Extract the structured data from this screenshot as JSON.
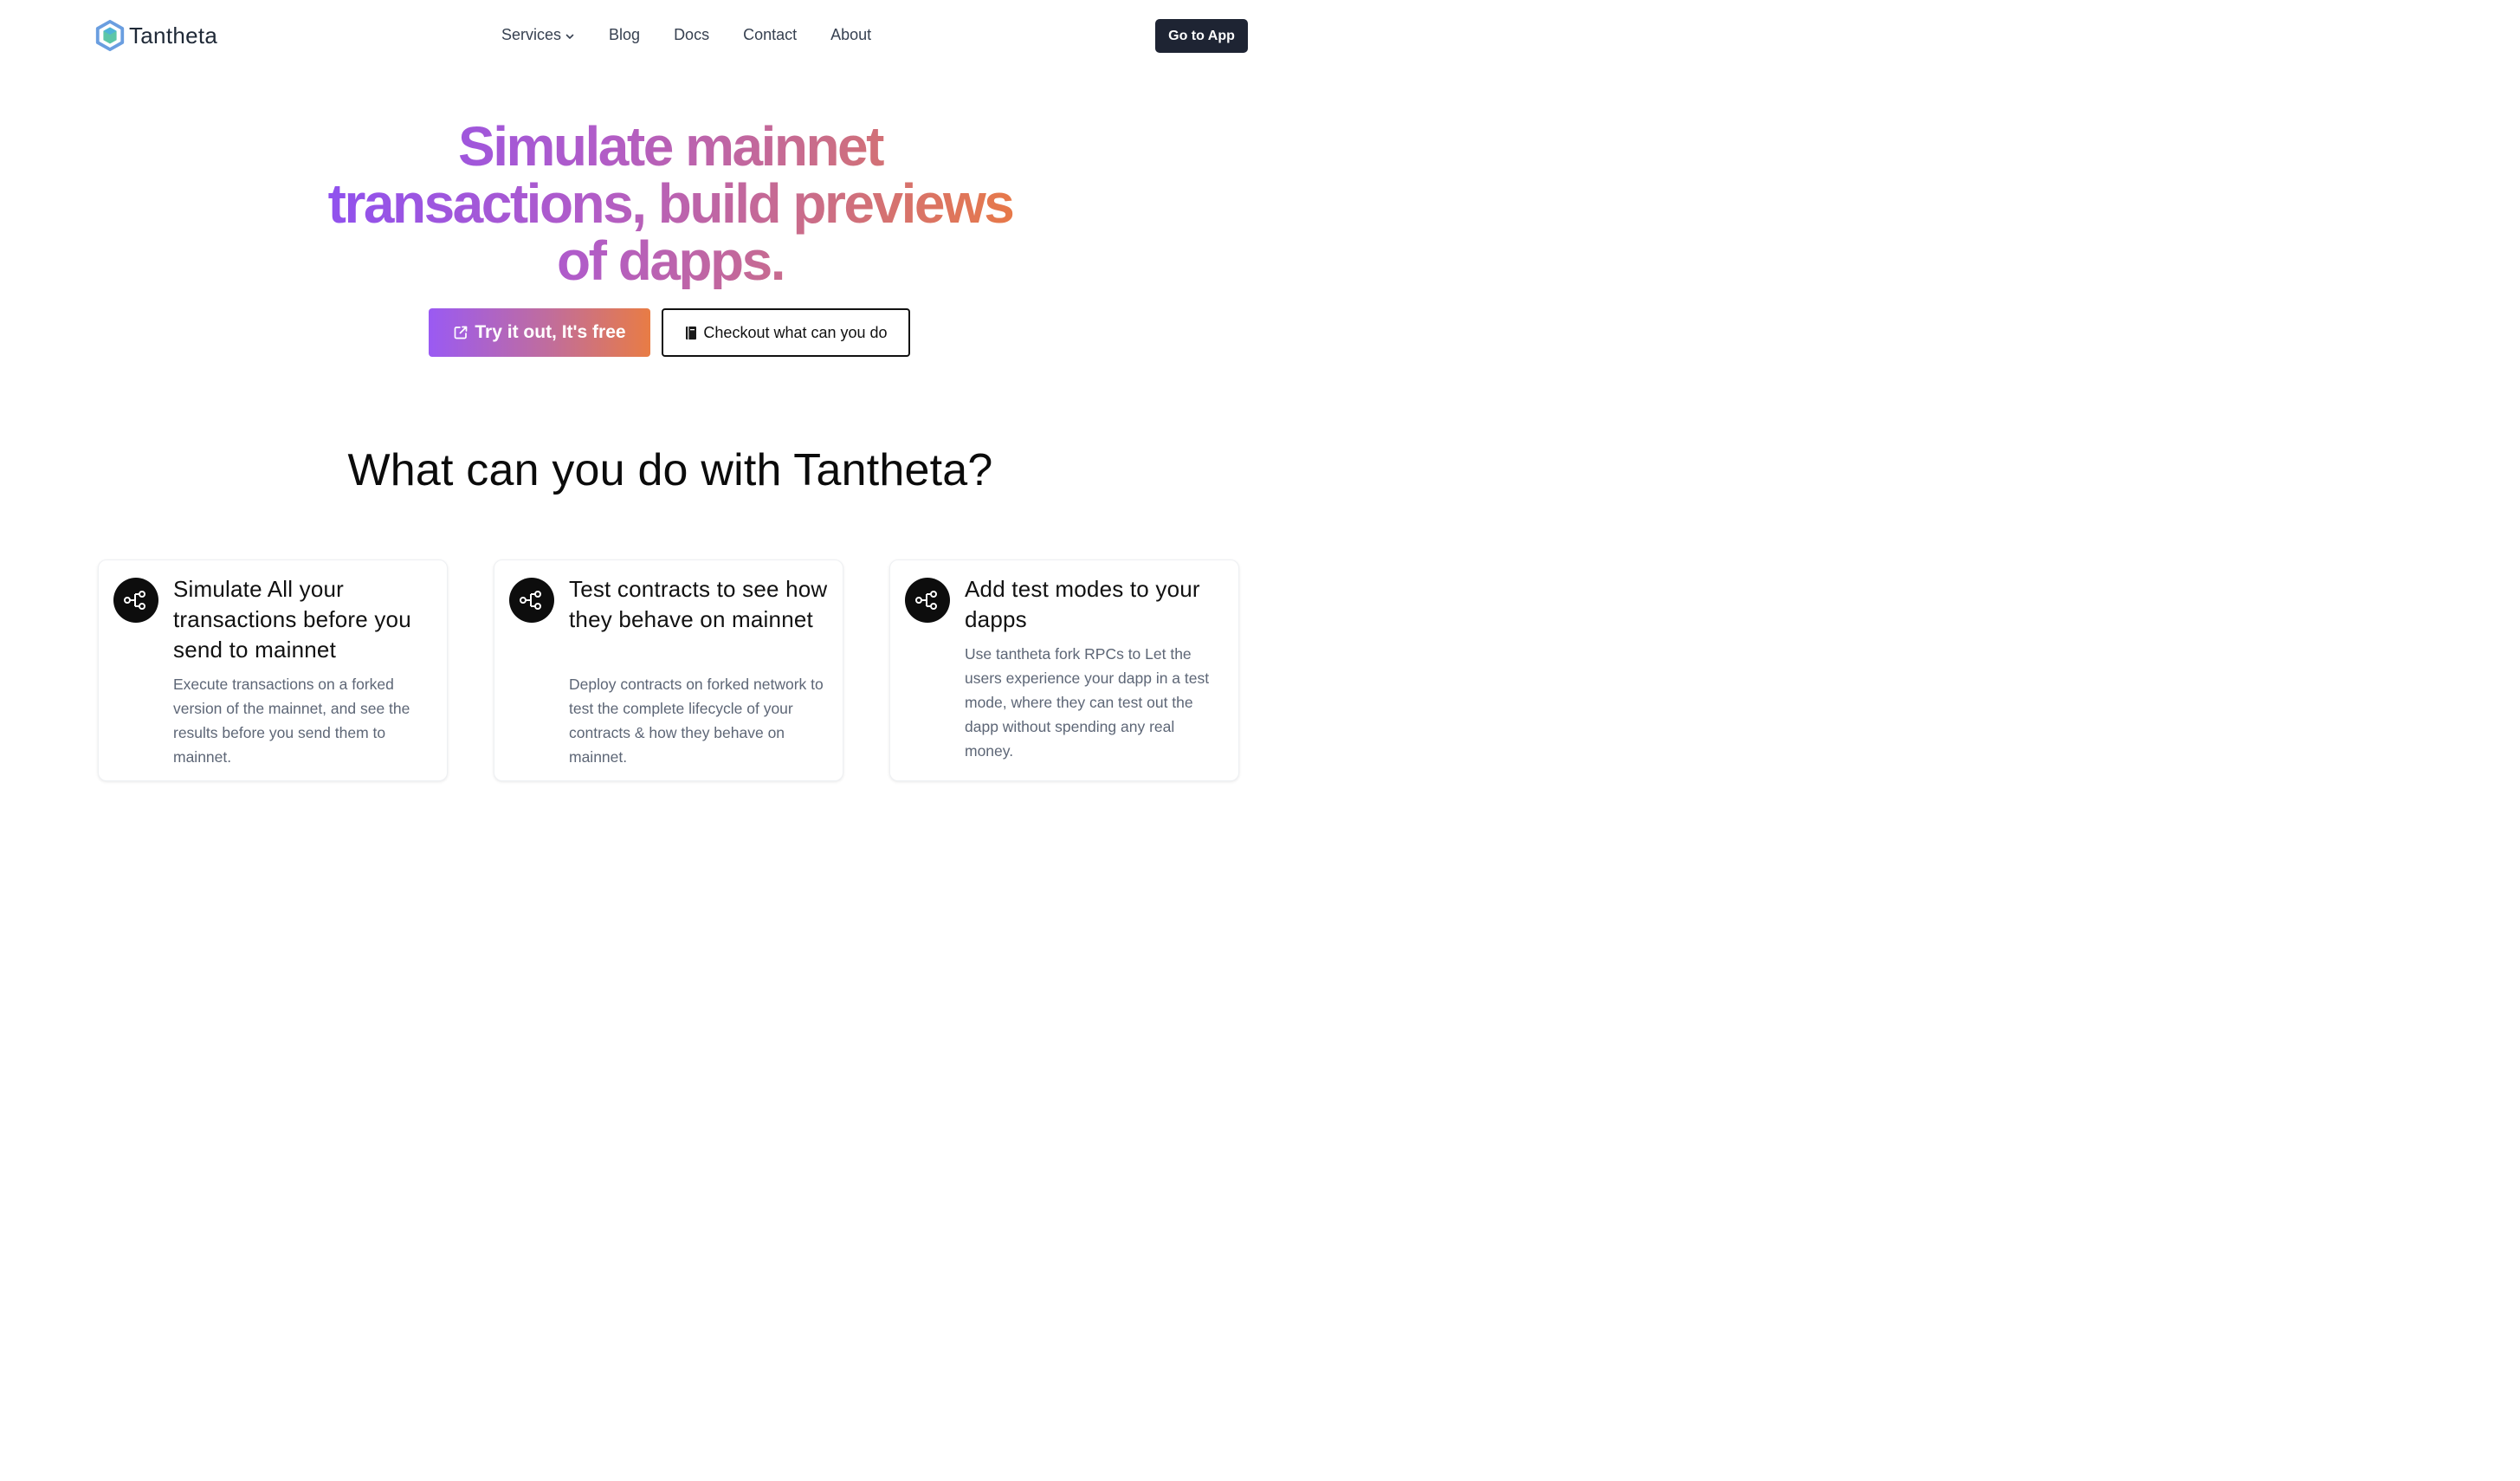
{
  "brand": {
    "name": "Tantheta",
    "logo_icon": "hexagon-logo-icon",
    "colors": {
      "logo_blue": "#6a9ee0",
      "logo_green": "#5cc6a7"
    }
  },
  "nav": {
    "links": [
      {
        "label": "Services",
        "has_dropdown": true
      },
      {
        "label": "Blog"
      },
      {
        "label": "Docs"
      },
      {
        "label": "Contact"
      },
      {
        "label": "About"
      }
    ],
    "cta_label": "Go to App"
  },
  "hero": {
    "title_lines": [
      "Simulate mainnet",
      "transactions, build previews",
      "of dapps."
    ],
    "gradient": {
      "from": "#8f51ef",
      "mid": "#c36a96",
      "to": "#ea7a42"
    },
    "primary_button": {
      "label": "Try it out, It's free",
      "icon": "external-link-icon"
    },
    "secondary_button": {
      "label": "Checkout what can you do",
      "icon": "notebook-icon"
    }
  },
  "features": {
    "heading": "What can you do with Tantheta?",
    "cards": [
      {
        "icon": "workflow-nodes-icon",
        "title": "Simulate All your transactions before you send to mainnet",
        "description": "Execute transactions on a forked version of the mainnet, and see the results before you send them to mainnet."
      },
      {
        "icon": "workflow-nodes-icon",
        "title": "Test contracts to see how they behave on mainnet",
        "description": "Deploy contracts on forked network to test the complete lifecycle of your contracts & how they behave on mainnet."
      },
      {
        "icon": "workflow-nodes-icon",
        "title": "Add test modes to your dapps",
        "description": "Use tantheta fork RPCs to Let the users experience your dapp in a test mode, where they can test out the dapp without spending any real money."
      }
    ]
  }
}
